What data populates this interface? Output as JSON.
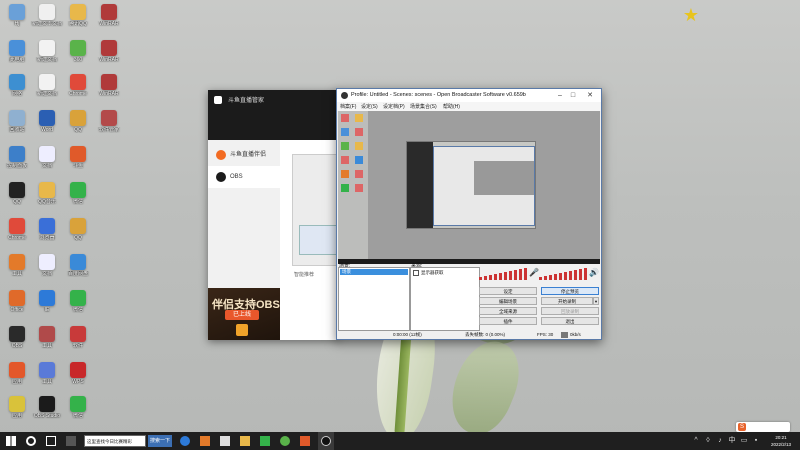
{
  "desktop": {
    "icons": [
      {
        "label": "Hj",
        "color": "#6aa0d8"
      },
      {
        "label": "新建文本文档",
        "color": "#f0f0f0"
      },
      {
        "label": "腾讯QQ",
        "color": "#e8b84a"
      },
      {
        "label": "WinRAR",
        "color": "#b03a3a"
      },
      {
        "label": "此电脑",
        "color": "#4a90d9"
      },
      {
        "label": "新建文档",
        "color": "#f2f2f2"
      },
      {
        "label": "360",
        "color": "#5ab34a"
      },
      {
        "label": "WinRAR",
        "color": "#b03a3a"
      },
      {
        "label": "网络",
        "color": "#3d8fd1"
      },
      {
        "label": "新建文档",
        "color": "#f2f2f2"
      },
      {
        "label": "Chrome",
        "color": "#e04a3a"
      },
      {
        "label": "WinRAR",
        "color": "#b03a3a"
      },
      {
        "label": "回收站",
        "color": "#8fb0d0"
      },
      {
        "label": "Word",
        "color": "#2b5fb3"
      },
      {
        "label": "QQ",
        "color": "#d9a23a"
      },
      {
        "label": "软件管家",
        "color": "#b34a4a"
      },
      {
        "label": "控制面板",
        "color": "#3d7fc9"
      },
      {
        "label": "文档",
        "color": "#eef"
      },
      {
        "label": "斗鱼",
        "color": "#e05a2a"
      },
      {
        "label": "QQ",
        "color": "#222"
      },
      {
        "label": "QQ音乐",
        "color": "#e8b84a"
      },
      {
        "label": "微信",
        "color": "#34b24a"
      },
      {
        "label": "Chrome",
        "color": "#e04a3a"
      },
      {
        "label": "浏览器",
        "color": "#3a6fd8"
      },
      {
        "label": "QQ",
        "color": "#d9a23a"
      },
      {
        "label": "工具",
        "color": "#e37a2a"
      },
      {
        "label": "文档",
        "color": "#eef"
      },
      {
        "label": "百度网盘",
        "color": "#3a8ad8"
      },
      {
        "label": "Office",
        "color": "#e06a2a"
      },
      {
        "label": "IE",
        "color": "#2d7ad8"
      },
      {
        "label": "微信",
        "color": "#34b24a"
      },
      {
        "label": "OBS",
        "color": "#2a2a2a"
      },
      {
        "label": "工具",
        "color": "#b04a4a"
      },
      {
        "label": "软件",
        "color": "#c83a3a"
      },
      {
        "label": "应用",
        "color": "#e3572a"
      },
      {
        "label": "工具",
        "color": "#5a7ad8"
      },
      {
        "label": "WPS",
        "color": "#c8282a"
      },
      {
        "label": "应用",
        "color": "#d9c23a"
      },
      {
        "label": "OBS Studio",
        "color": "#1b1b1b"
      },
      {
        "label": "微信",
        "color": "#34b24a"
      }
    ]
  },
  "douyu_window": {
    "title": "斗鱼直播管家",
    "nav": [
      {
        "label": "斗鱼直播伴侣",
        "icon": "douyu-icon",
        "color": "#f26b22"
      },
      {
        "label": "OBS",
        "icon": "obs-icon",
        "color": "#1b1b1b"
      }
    ],
    "smart_label": "智能推荐",
    "banner_title": "伴侣支持OBS",
    "banner_badge": "已上线"
  },
  "obs_window": {
    "title": "Profile: Untitled - Scenes: scenes - Open Broadcaster Software v0.659b",
    "menu": [
      "档案(F)",
      "设定(S)",
      "设定档(P)",
      "场景集合(S)",
      "帮助(H)"
    ],
    "scenes_label": "场景:",
    "scene_selected": "场景",
    "sources_label": "来源:",
    "source_item": "显示器获取",
    "buttons": {
      "settings": "设定",
      "stop_preview": "停止预览",
      "edit_scene": "编辑场景",
      "start_record": "开始录制",
      "global_sources": "全域来源",
      "record_replay": "回放录制",
      "plugins": "插件",
      "exit": "退出"
    },
    "status": {
      "time": "0:00:00 (12帧)",
      "dropped": "丢失帧数: 0 (0.00%)",
      "fps": "FPS: 30",
      "bitrate": "0kb/s"
    }
  },
  "taskbar": {
    "address_text": "这里查找今日比赛精彩",
    "search_label": "搜索一下",
    "clock_time": "20:21",
    "clock_date": "2022/2/13",
    "accent": "#1f1f1f"
  }
}
